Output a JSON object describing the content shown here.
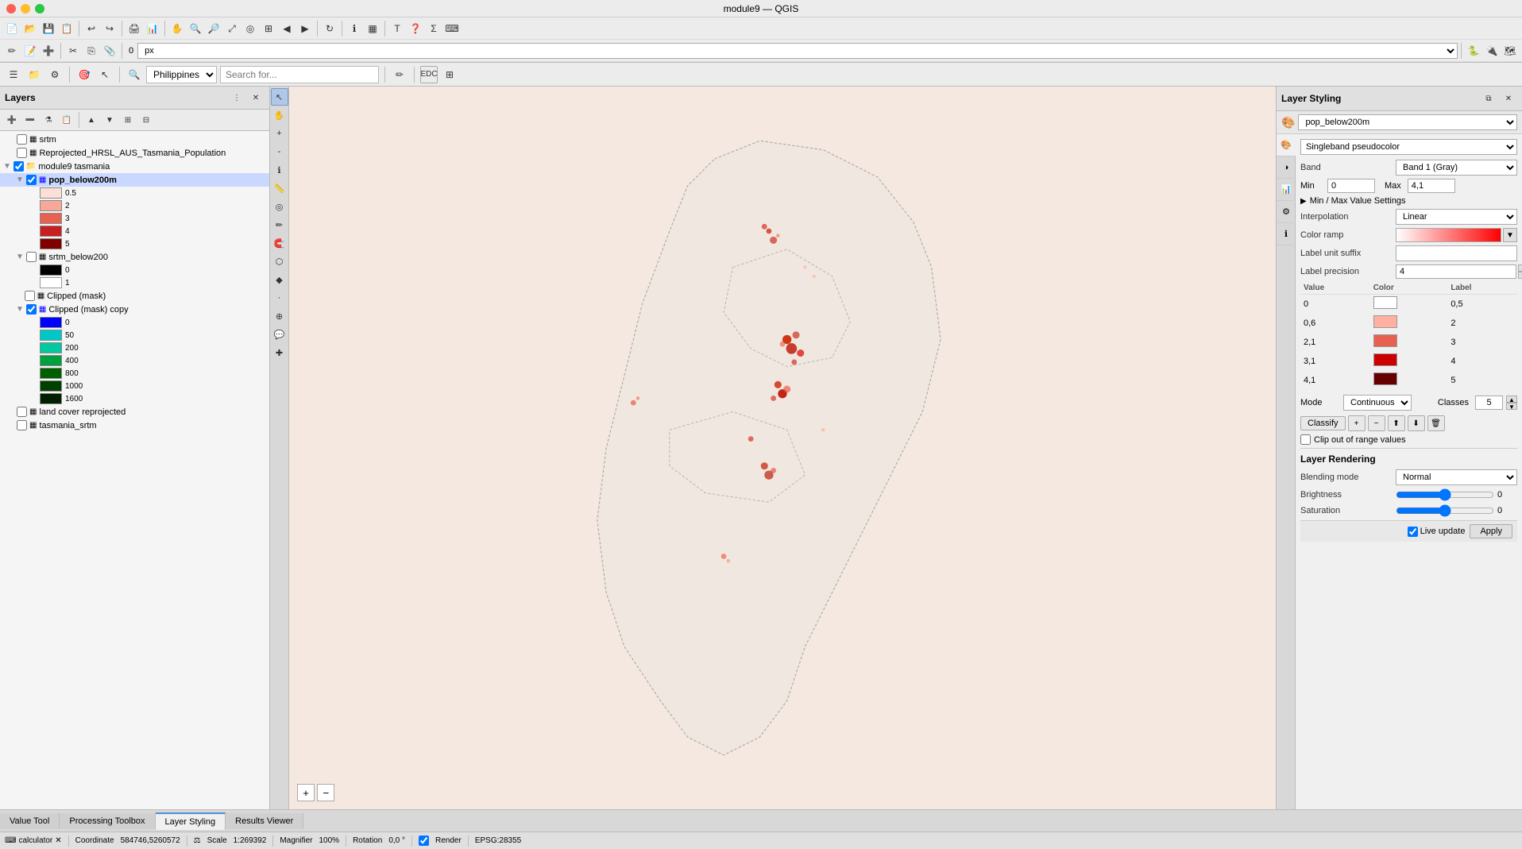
{
  "window": {
    "title": "module9 — QGIS"
  },
  "titlebar": {
    "title": "module9 — QGIS"
  },
  "toolbar": {
    "rows": 4
  },
  "searchbar": {
    "location": "Philippines",
    "placeholder": "Search for...",
    "label": "Search for  _"
  },
  "layers_panel": {
    "title": "Layers",
    "items": [
      {
        "name": "srtm",
        "checked": false,
        "type": "raster",
        "indent": 0
      },
      {
        "name": "Reprojected_HRSL_AUS_Tasmania_Population",
        "checked": false,
        "type": "raster",
        "indent": 0
      },
      {
        "name": "module9 tasmania",
        "checked": true,
        "type": "group",
        "indent": 0
      },
      {
        "name": "pop_below200m",
        "checked": true,
        "type": "raster",
        "indent": 1,
        "selected": true
      },
      {
        "name": "srtm_below200",
        "checked": false,
        "type": "raster",
        "indent": 1
      },
      {
        "name": "Clipped (mask)",
        "checked": false,
        "type": "raster",
        "indent": 1
      },
      {
        "name": "Clipped (mask) copy",
        "checked": true,
        "type": "raster",
        "indent": 1
      },
      {
        "name": "land cover reprojected",
        "checked": false,
        "type": "raster",
        "indent": 0
      },
      {
        "name": "tasmania_srtm",
        "checked": false,
        "type": "raster",
        "indent": 0
      }
    ],
    "legends": {
      "pop_below200m": [
        {
          "value": "0.5",
          "color": "#fce0d8"
        },
        {
          "value": "2",
          "color": "#f7a89a"
        },
        {
          "value": "3",
          "color": "#e86050"
        },
        {
          "value": "4",
          "color": "#c82020"
        },
        {
          "value": "5",
          "color": "#800000"
        }
      ],
      "srtm_below200": [
        {
          "value": "0",
          "color": "#000000"
        },
        {
          "value": "1",
          "color": "#ffffff"
        }
      ],
      "clipped_copy": [
        {
          "value": "0",
          "color": "#0000ff"
        },
        {
          "value": "50",
          "color": "#00c8c8"
        },
        {
          "value": "200",
          "color": "#00c8a0"
        },
        {
          "value": "400",
          "color": "#00a040"
        },
        {
          "value": "800",
          "color": "#006000"
        },
        {
          "value": "1000",
          "color": "#004000"
        },
        {
          "value": "1600",
          "color": "#002000"
        }
      ]
    }
  },
  "styling_panel": {
    "title": "Layer Styling",
    "layer_name": "pop_below200m",
    "renderer": "Singleband pseudocolor",
    "band_label": "Band",
    "band_value": "Band 1 (Gray)",
    "min_label": "Min",
    "min_value": "0",
    "max_label": "Max",
    "max_value": "4,1",
    "min_max_section": "Min / Max Value Settings",
    "interpolation_label": "Interpolation",
    "interpolation_value": "Linear",
    "color_ramp_label": "Color ramp",
    "label_unit_suffix_label": "Label unit suffix",
    "label_unit_suffix_value": "",
    "label_precision_label": "Label precision",
    "label_precision_value": "4",
    "table_headers": [
      "Value",
      "Color",
      "Label"
    ],
    "color_table": [
      {
        "value": "0",
        "color": "#ffffff",
        "label": "0,5"
      },
      {
        "value": "0,6",
        "color": "#ffb0a0",
        "label": "2"
      },
      {
        "value": "2,1",
        "color": "#e86050",
        "label": "3"
      },
      {
        "value": "3,1",
        "color": "#cc0000",
        "label": "4"
      },
      {
        "value": "4,1",
        "color": "#660000",
        "label": "5"
      }
    ],
    "mode_label": "Mode",
    "mode_value": "Continuous",
    "classes_label": "Classes",
    "classes_value": "5",
    "classify_btn": "Classify",
    "clip_out_label": "Clip out of range values",
    "layer_rendering_title": "Layer Rendering",
    "blending_label": "Blending mode",
    "blending_value": "Normal",
    "brightness_label": "Brightness",
    "brightness_value": "0",
    "saturation_label": "Saturation",
    "saturation_value": "0",
    "live_update_label": "Live update",
    "apply_label": "Apply"
  },
  "bottom_tabs": [
    {
      "label": "Value Tool",
      "active": false
    },
    {
      "label": "Processing Toolbox",
      "active": false
    },
    {
      "label": "Layer Styling",
      "active": true
    },
    {
      "label": "Results Viewer",
      "active": false
    }
  ],
  "status_bar": {
    "coordinate_label": "Coordinate",
    "coordinate_value": "584746,5260572",
    "scale_label": "Scale",
    "scale_value": "1:269392",
    "magnifier_label": "Magnifier",
    "magnifier_value": "100%",
    "rotation_label": "Rotation",
    "rotation_value": "0,0 °",
    "render_label": "Render",
    "epsg_value": "EPSG:28355",
    "calculator_label": "calculator"
  }
}
